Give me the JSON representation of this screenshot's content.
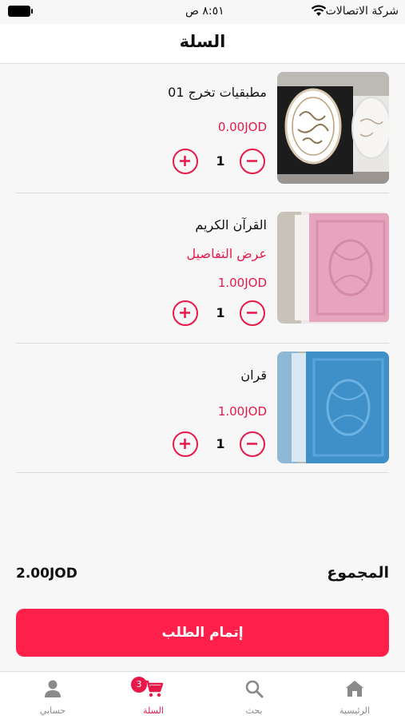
{
  "status_bar": {
    "carrier": "شركة الاتصالات",
    "time": "٨:٥١ ص"
  },
  "header": {
    "title": "السلة"
  },
  "items": [
    {
      "name": "مطبقيات تخرج 01",
      "price": "0.00JOD",
      "quantity": "1"
    },
    {
      "name": "القرآن الكريم",
      "details_link": "عرض التفاصيل",
      "price": "1.00JOD",
      "quantity": "1"
    },
    {
      "name": "قران",
      "price": "1.00JOD",
      "quantity": "1"
    }
  ],
  "total": {
    "label": "المجموع",
    "value": "2.00JOD"
  },
  "checkout_label": "إتمام الطلب",
  "tabs": [
    {
      "label": "الرئيسية",
      "icon": "home-icon"
    },
    {
      "label": "بحث",
      "icon": "search-icon"
    },
    {
      "label": "السلة",
      "icon": "cart-icon",
      "badge": "3",
      "active": true
    },
    {
      "label": "حسابي",
      "icon": "user-icon"
    }
  ],
  "colors": {
    "accent": "#e8194a",
    "checkout_bg": "#ff1f4b"
  }
}
